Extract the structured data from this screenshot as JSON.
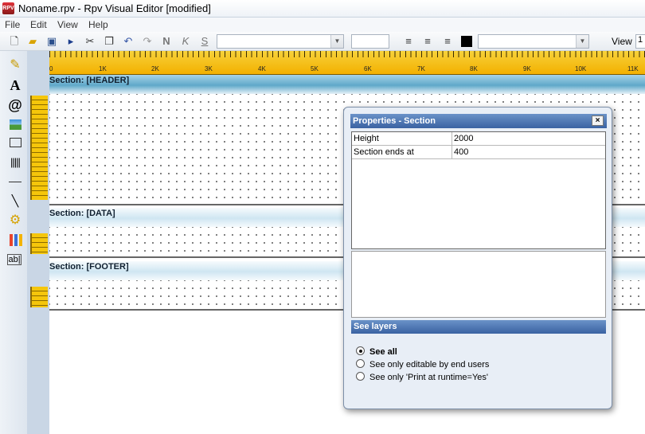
{
  "window": {
    "title": "Noname.rpv - Rpv Visual Editor [modified]",
    "icon_text": "RPV"
  },
  "menu": [
    "File",
    "Edit",
    "View",
    "Help"
  ],
  "toolbar": {
    "view_label": "View",
    "view_value": "1"
  },
  "ruler_labels": [
    "0",
    "1K",
    "2K",
    "3K",
    "4K",
    "5K",
    "6K",
    "7K",
    "8K",
    "9K",
    "10K",
    "11K"
  ],
  "sections": [
    {
      "label": "Section: [HEADER]"
    },
    {
      "label": "Section: [DATA]"
    },
    {
      "label": "Section: [FOOTER]"
    }
  ],
  "dialog": {
    "title": "Properties - Section",
    "close": "×",
    "properties": [
      {
        "key": "Height",
        "value": "2000"
      },
      {
        "key": "Section ends at",
        "value": "400"
      }
    ],
    "layers_title": "See layers",
    "options": [
      {
        "label": "See all",
        "selected": true
      },
      {
        "label": "See only editable by end users",
        "selected": false
      },
      {
        "label": "See only 'Print at runtime=Yes'",
        "selected": false
      }
    ]
  }
}
